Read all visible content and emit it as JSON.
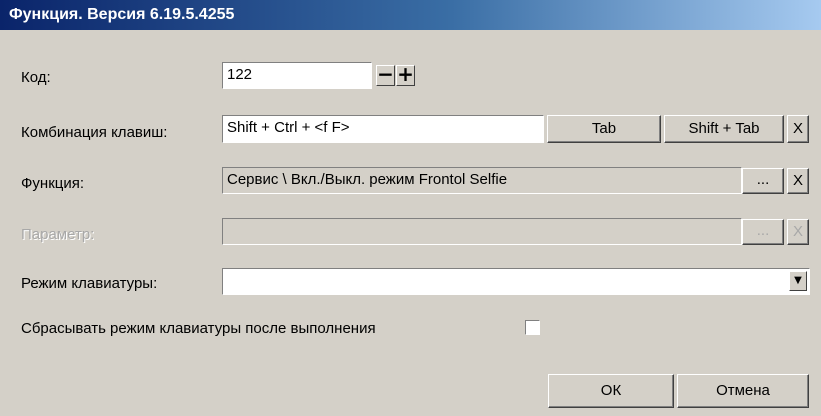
{
  "window": {
    "title": "Функция. Версия 6.19.5.4255"
  },
  "code": {
    "label": "Код:",
    "value": "122",
    "decrement": "−",
    "increment": "+"
  },
  "hotkey": {
    "label": "Комбинация клавиш:",
    "value": "Shift + Ctrl + <f F>",
    "tab_button": "Tab",
    "shift_tab_button": "Shift + Tab",
    "clear_button": "X"
  },
  "function": {
    "label": "Функция:",
    "value": "Сервис \\ Вкл./Выкл. режим Frontol Selfie",
    "browse_button": "...",
    "clear_button": "X"
  },
  "parameter": {
    "label": "Параметр:",
    "value": "",
    "browse_button": "...",
    "clear_button": "X",
    "enabled": false
  },
  "keyboard_mode": {
    "label": "Режим клавиатуры:",
    "value": "",
    "dropdown_icon": "▼"
  },
  "reset_after": {
    "label": "Сбрасывать режим клавиатуры после выполнения",
    "checked": false
  },
  "actions": {
    "ok": "ОК",
    "cancel": "Отмена"
  }
}
